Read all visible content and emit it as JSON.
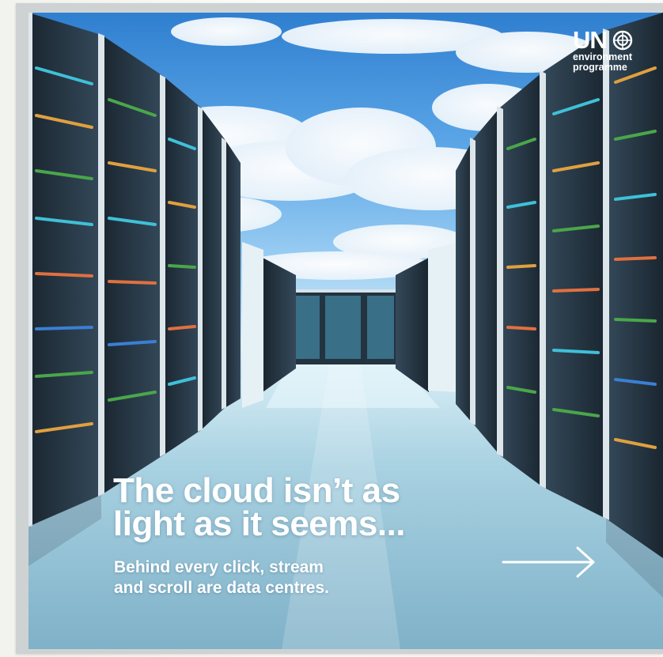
{
  "post": {
    "headline_lines": [
      "The cloud isn’t as",
      "light as it seems..."
    ],
    "sub_lines": [
      "Behind every click, stream",
      "and scroll are data centres."
    ]
  },
  "logo": {
    "main": "UN",
    "line1": "environment",
    "line2": "programme",
    "emblem_icon": "un-emblem-icon"
  },
  "navigation": {
    "next_icon": "arrow-right-icon"
  },
  "colors": {
    "sky_top": "#2f7fd0",
    "floor": "#8fbfd4",
    "rack": "#22313c",
    "text": "#ffffff"
  }
}
